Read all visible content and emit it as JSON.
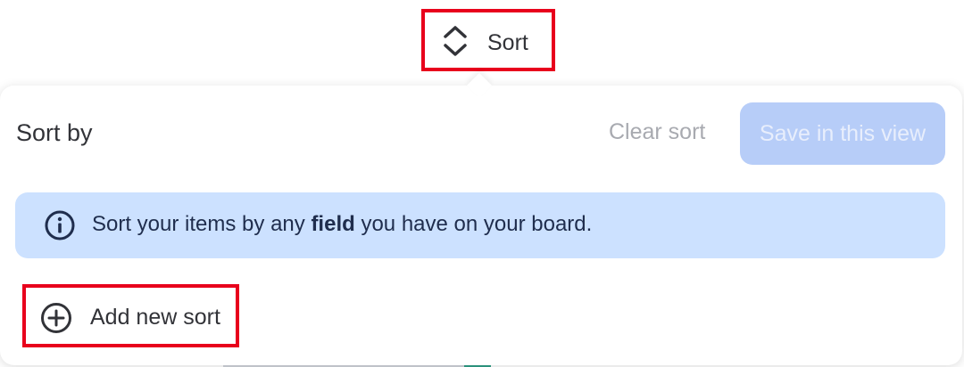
{
  "sort_trigger": {
    "label": "Sort",
    "icon": "sort-chevrons-icon"
  },
  "popover": {
    "title": "Sort by",
    "clear_label": "Clear sort",
    "save_label": "Save in this view",
    "info": {
      "icon": "info-icon",
      "text_before": "Sort your items by any ",
      "text_bold": "field",
      "text_after": " you have on your board."
    },
    "add_sort_label": "Add new sort",
    "add_sort_icon": "plus-circle-icon"
  },
  "colors": {
    "highlight_border": "#e8001c",
    "save_button_disabled": "#b7cdf8",
    "info_banner_bg": "#cce1ff"
  }
}
